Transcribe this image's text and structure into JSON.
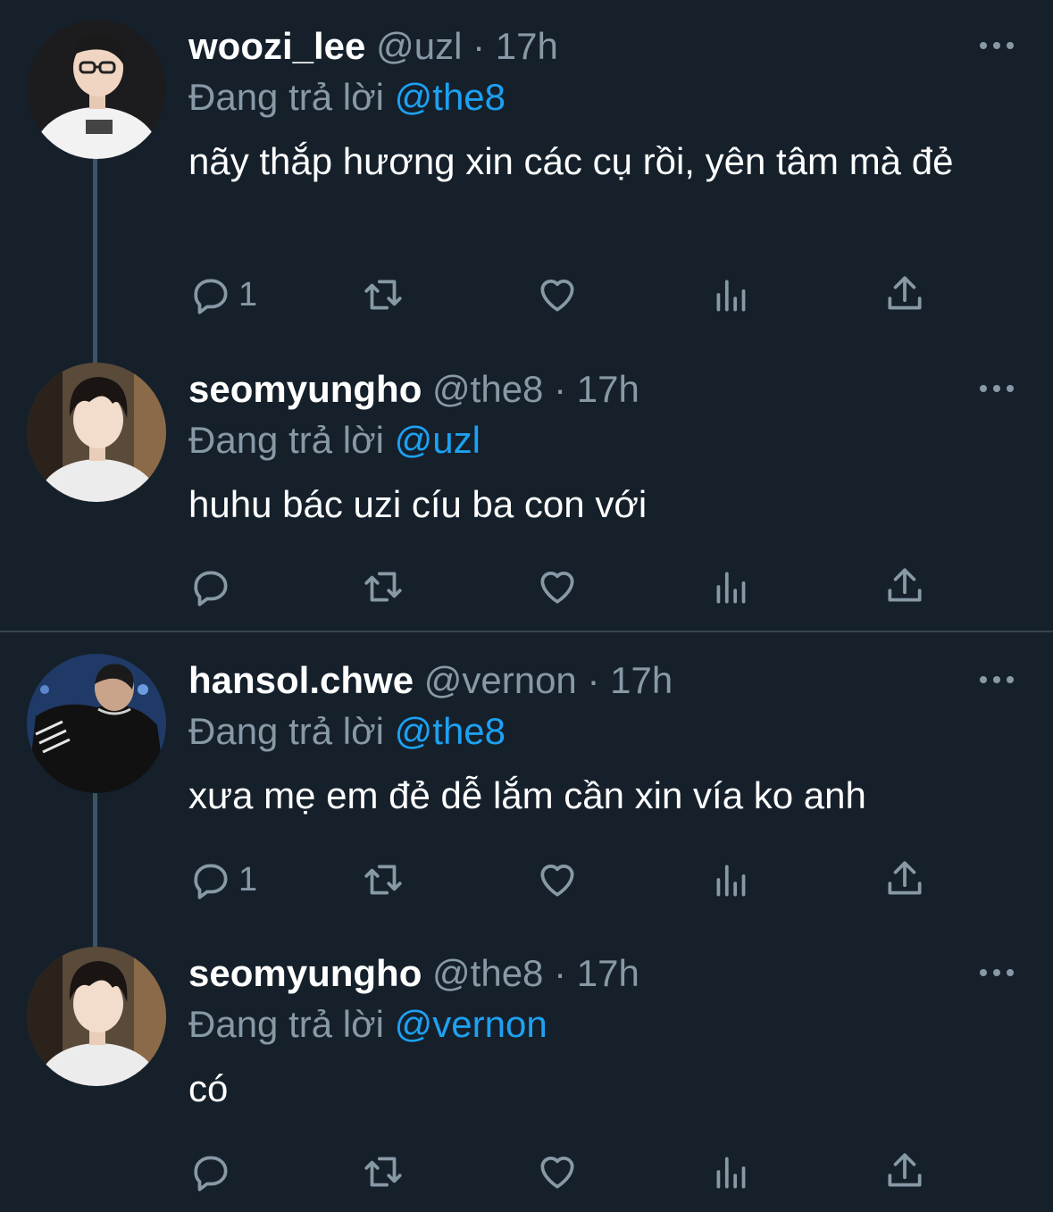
{
  "tweets": [
    {
      "name": "woozi_lee",
      "handle": "@uzl",
      "dot": "·",
      "time": "17h",
      "reply_label": "Đang trả lời",
      "reply_mention": "@the8",
      "text": "nãy thắp hương xin các cụ rồi, yên tâm mà đẻ",
      "reply_count": "1",
      "avatar": "avatar-woozi"
    },
    {
      "name": "seomyungho",
      "handle": "@the8",
      "dot": "·",
      "time": "17h",
      "reply_label": "Đang trả lời",
      "reply_mention": "@uzl",
      "text": "huhu bác uzi cíu ba con với",
      "reply_count": "",
      "avatar": "avatar-the8"
    },
    {
      "name": "hansol.chwe",
      "handle": "@vernon",
      "dot": "·",
      "time": "17h",
      "reply_label": "Đang trả lời",
      "reply_mention": "@the8",
      "text": "xưa mẹ em đẻ dễ lắm cần xin vía ko anh",
      "reply_count": "1",
      "avatar": "avatar-vernon"
    },
    {
      "name": "seomyungho",
      "handle": "@the8",
      "dot": "·",
      "time": "17h",
      "reply_label": "Đang trả lời",
      "reply_mention": "@vernon",
      "text": "có",
      "reply_count": "",
      "avatar": "avatar-the8"
    }
  ],
  "icons": {
    "reply": "reply-icon",
    "retweet": "retweet-icon",
    "like": "heart-icon",
    "analytics": "analytics-icon",
    "share": "share-icon",
    "more": "more-icon"
  },
  "colors": {
    "background": "#15202b",
    "secondary_text": "#8899a6",
    "mention": "#1da1f2",
    "thread_line": "#3d5466",
    "divider": "#38444d"
  }
}
